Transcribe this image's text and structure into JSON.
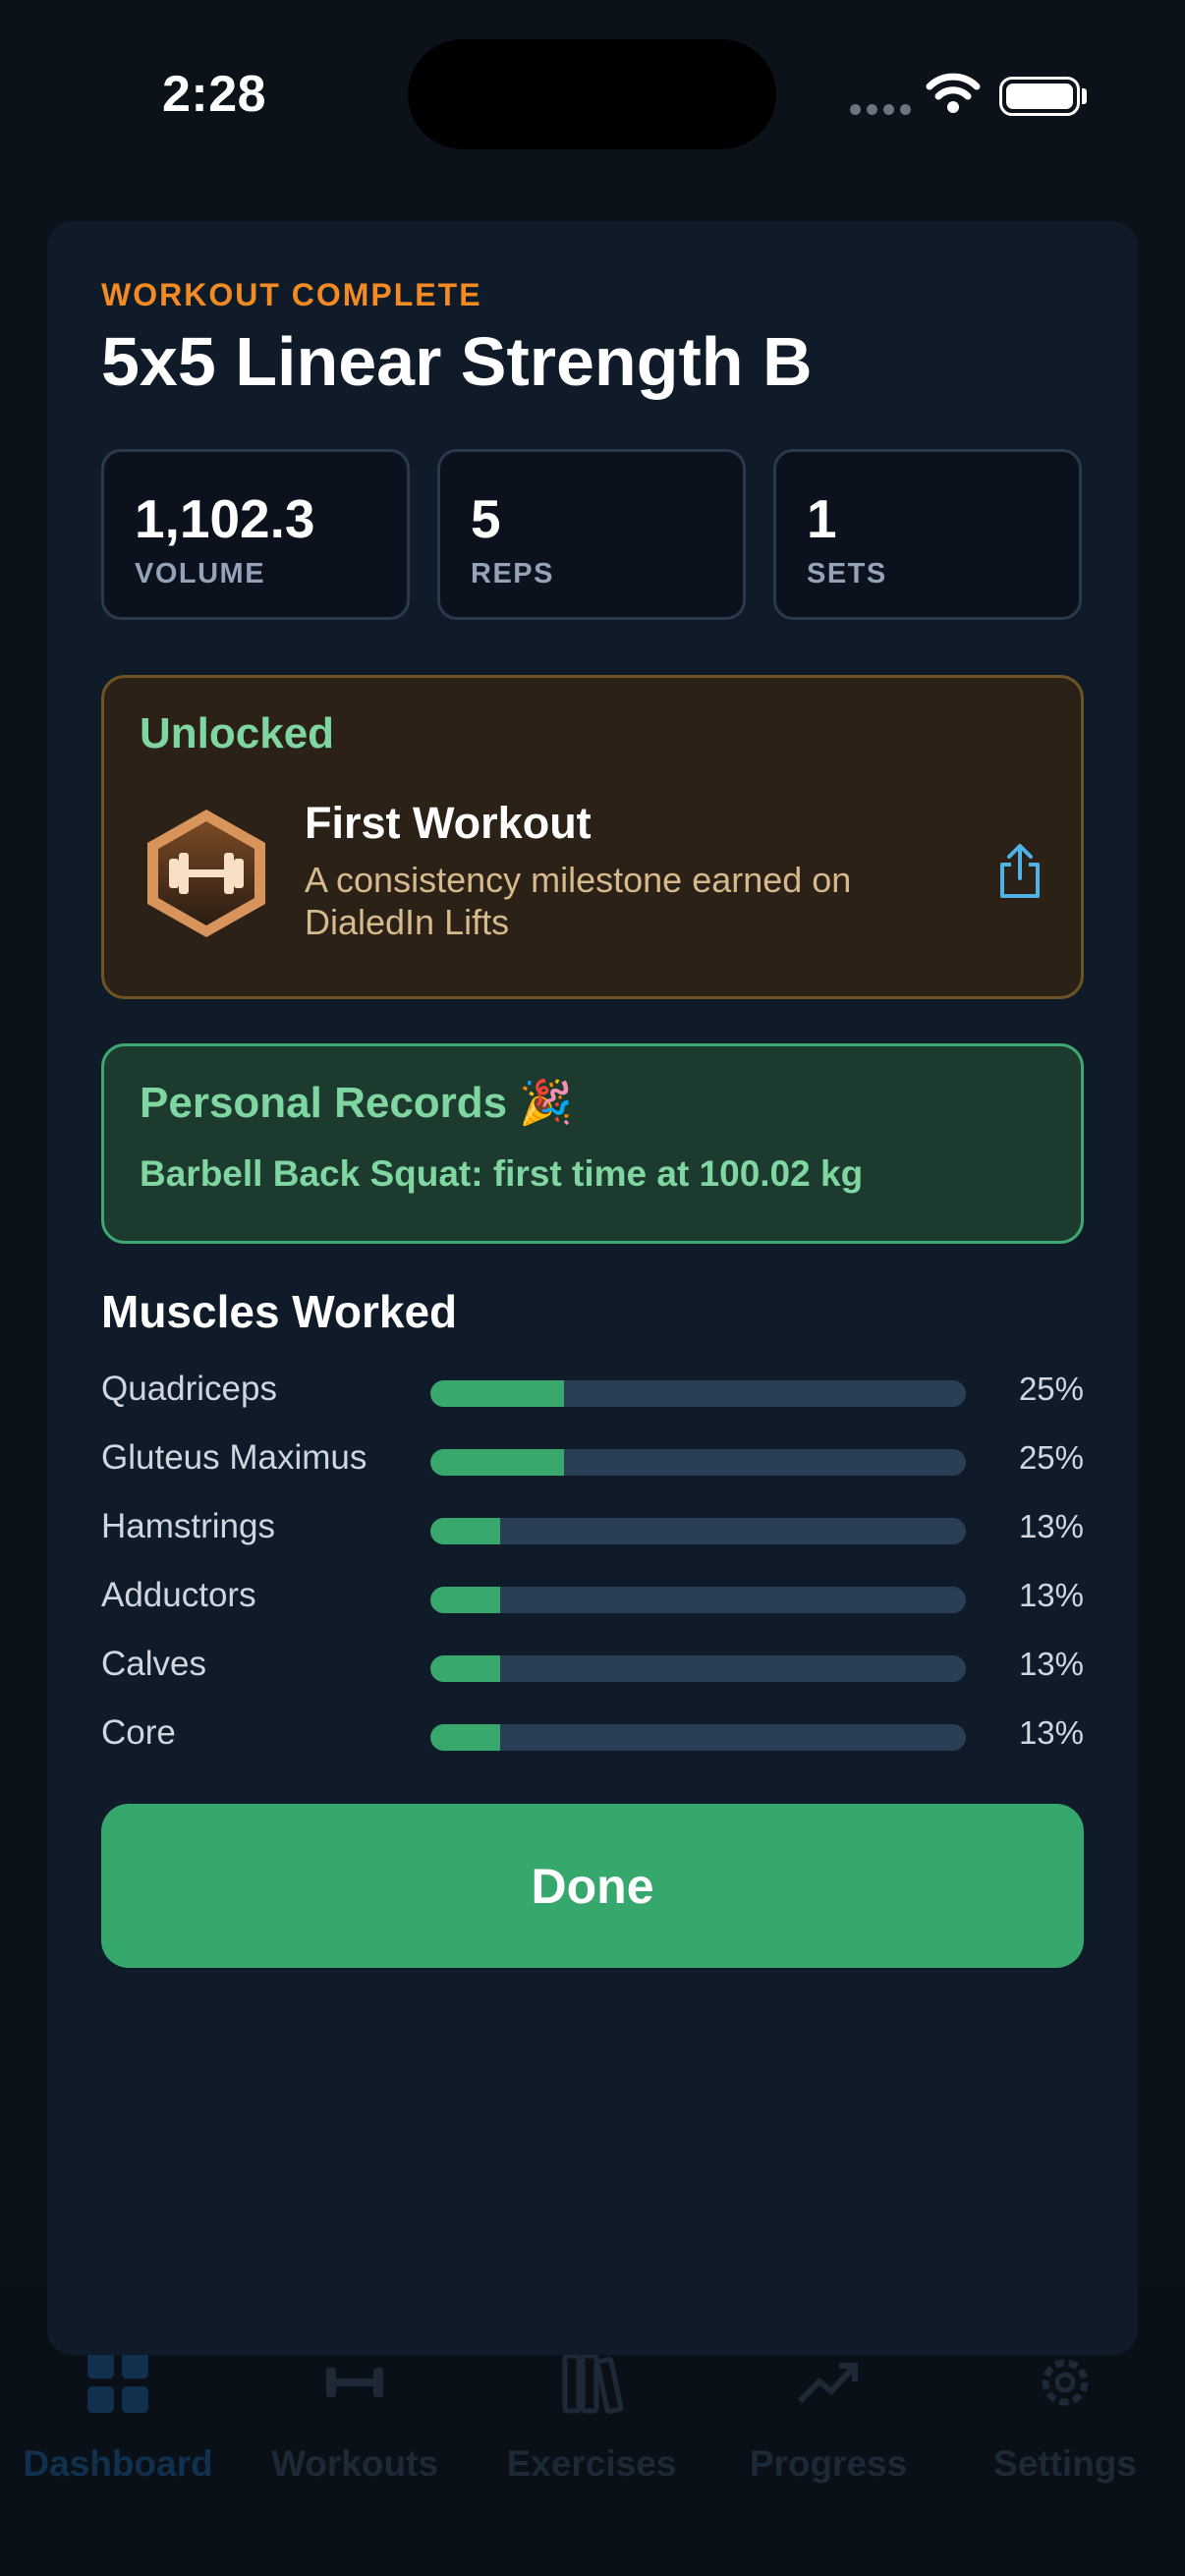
{
  "status_bar": {
    "time": "2:28"
  },
  "sheet": {
    "kicker": "WORKOUT COMPLETE",
    "title": "5x5 Linear Strength B",
    "stats": [
      {
        "value": "1,102.3",
        "label": "VOLUME"
      },
      {
        "value": "5",
        "label": "REPS"
      },
      {
        "value": "1",
        "label": "SETS"
      }
    ],
    "unlocked": {
      "heading": "Unlocked",
      "achievement_title": "First Workout",
      "achievement_desc": "A consistency milestone earned on DialedIn Lifts",
      "badge_icon": "dumbbell-badge-icon",
      "share_icon": "share-icon"
    },
    "personal_records": {
      "heading": "Personal Records 🎉",
      "line": "Barbell Back Squat: first time at 100.02 kg"
    },
    "muscles": {
      "heading": "Muscles Worked",
      "items": [
        {
          "name": "Quadriceps",
          "pct_label": "25%",
          "pct": 25
        },
        {
          "name": "Gluteus Maximus",
          "pct_label": "25%",
          "pct": 25
        },
        {
          "name": "Hamstrings",
          "pct_label": "13%",
          "pct": 13
        },
        {
          "name": "Adductors",
          "pct_label": "13%",
          "pct": 13
        },
        {
          "name": "Calves",
          "pct_label": "13%",
          "pct": 13
        },
        {
          "name": "Core",
          "pct_label": "13%",
          "pct": 13
        }
      ]
    },
    "done_label": "Done"
  },
  "tab_bar": {
    "tabs": [
      {
        "label": "Dashboard",
        "icon": "grid-icon",
        "active": true
      },
      {
        "label": "Workouts",
        "icon": "dumbbell-icon",
        "active": false
      },
      {
        "label": "Exercises",
        "icon": "books-icon",
        "active": false
      },
      {
        "label": "Progress",
        "icon": "trend-icon",
        "active": false
      },
      {
        "label": "Settings",
        "icon": "gear-icon",
        "active": false
      }
    ]
  },
  "colors": {
    "accent_orange": "#f38a22",
    "accent_green": "#38a86d",
    "pr_text": "#7fd6a1",
    "sheet_bg": "#101b29"
  }
}
